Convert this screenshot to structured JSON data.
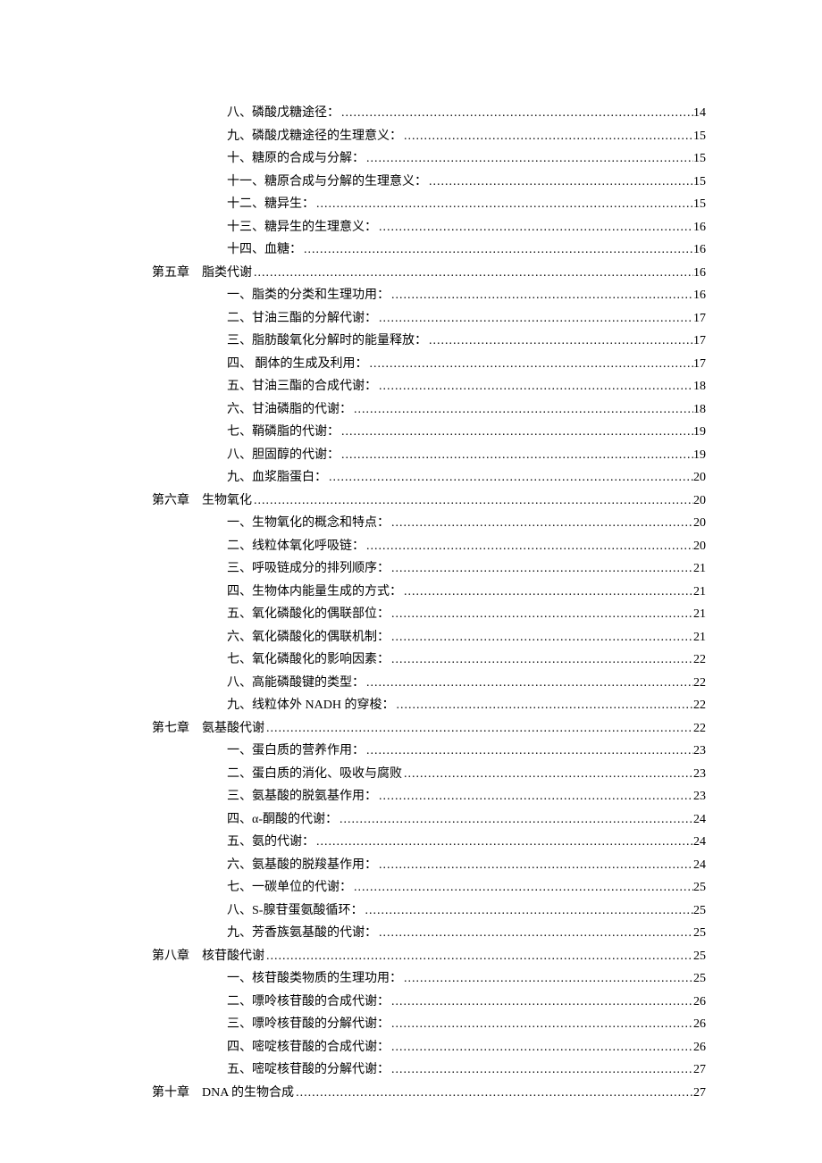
{
  "toc": [
    {
      "type": "section",
      "label": "八、磷酸戊糖途径：",
      "page": "14"
    },
    {
      "type": "section",
      "label": "九、磷酸戊糖途径的生理意义：",
      "page": "15"
    },
    {
      "type": "section",
      "label": "十、糖原的合成与分解：",
      "page": "15"
    },
    {
      "type": "section",
      "label": "十一、糖原合成与分解的生理意义：",
      "page": "15"
    },
    {
      "type": "section",
      "label": "十二、糖异生：",
      "page": "15"
    },
    {
      "type": "section",
      "label": "十三、糖异生的生理意义：",
      "page": "16"
    },
    {
      "type": "section",
      "label": "十四、血糖：",
      "page": "16"
    },
    {
      "type": "chapter",
      "label": "第五章　脂类代谢",
      "page": "16"
    },
    {
      "type": "section",
      "label": "一、脂类的分类和生理功用：",
      "page": "16"
    },
    {
      "type": "section",
      "label": "二、甘油三酯的分解代谢：",
      "page": "17"
    },
    {
      "type": "section",
      "label": "三、脂肪酸氧化分解时的能量释放：",
      "page": "17"
    },
    {
      "type": "section",
      "label": "四、 酮体的生成及利用：",
      "page": "17"
    },
    {
      "type": "section",
      "label": "五、甘油三酯的合成代谢：",
      "page": "18"
    },
    {
      "type": "section",
      "label": "六、甘油磷脂的代谢：",
      "page": "18"
    },
    {
      "type": "section",
      "label": "七、鞘磷脂的代谢：",
      "page": "19"
    },
    {
      "type": "section",
      "label": "八、胆固醇的代谢：",
      "page": "19"
    },
    {
      "type": "section",
      "label": "九、血浆脂蛋白：",
      "page": "20"
    },
    {
      "type": "chapter",
      "label": "第六章　生物氧化",
      "page": "20"
    },
    {
      "type": "section",
      "label": "一、生物氧化的概念和特点：",
      "page": "20"
    },
    {
      "type": "section",
      "label": "二、线粒体氧化呼吸链：",
      "page": "20"
    },
    {
      "type": "section",
      "label": "三、呼吸链成分的排列顺序：",
      "page": "21"
    },
    {
      "type": "section",
      "label": "四、生物体内能量生成的方式：",
      "page": "21"
    },
    {
      "type": "section",
      "label": "五、氧化磷酸化的偶联部位：",
      "page": "21"
    },
    {
      "type": "section",
      "label": "六、氧化磷酸化的偶联机制：",
      "page": "21"
    },
    {
      "type": "section",
      "label": "七、氧化磷酸化的影响因素：",
      "page": "22"
    },
    {
      "type": "section",
      "label": "八、高能磷酸键的类型：",
      "page": "22"
    },
    {
      "type": "section",
      "label": "九、线粒体外 NADH 的穿梭：",
      "page": "22"
    },
    {
      "type": "chapter",
      "label": "第七章　氨基酸代谢",
      "page": "22"
    },
    {
      "type": "section",
      "label": "一、蛋白质的营养作用：",
      "page": "23"
    },
    {
      "type": "section",
      "label": "二、蛋白质的消化、吸收与腐败",
      "page": "23"
    },
    {
      "type": "section",
      "label": "三、氨基酸的脱氨基作用：",
      "page": "23"
    },
    {
      "type": "section",
      "label": "四、α-酮酸的代谢：",
      "page": "24"
    },
    {
      "type": "section",
      "label": "五、氨的代谢：",
      "page": "24"
    },
    {
      "type": "section",
      "label": "六、氨基酸的脱羧基作用：",
      "page": "24"
    },
    {
      "type": "section",
      "label": "七、一碳单位的代谢：",
      "page": "25"
    },
    {
      "type": "section",
      "label": "八、S-腺苷蛋氨酸循环：",
      "page": "25"
    },
    {
      "type": "section",
      "label": "九、芳香族氨基酸的代谢：",
      "page": "25"
    },
    {
      "type": "chapter",
      "label": "第八章　核苷酸代谢",
      "page": "25"
    },
    {
      "type": "section",
      "label": "一、核苷酸类物质的生理功用：",
      "page": "25"
    },
    {
      "type": "section",
      "label": "二、嘌呤核苷酸的合成代谢：",
      "page": "26"
    },
    {
      "type": "section",
      "label": "三、嘌呤核苷酸的分解代谢：",
      "page": "26"
    },
    {
      "type": "section",
      "label": "四、嘧啶核苷酸的合成代谢：",
      "page": "26"
    },
    {
      "type": "section",
      "label": "五、嘧啶核苷酸的分解代谢：",
      "page": "27"
    },
    {
      "type": "chapter",
      "label": "第十章　DNA 的生物合成",
      "page": "27"
    }
  ]
}
